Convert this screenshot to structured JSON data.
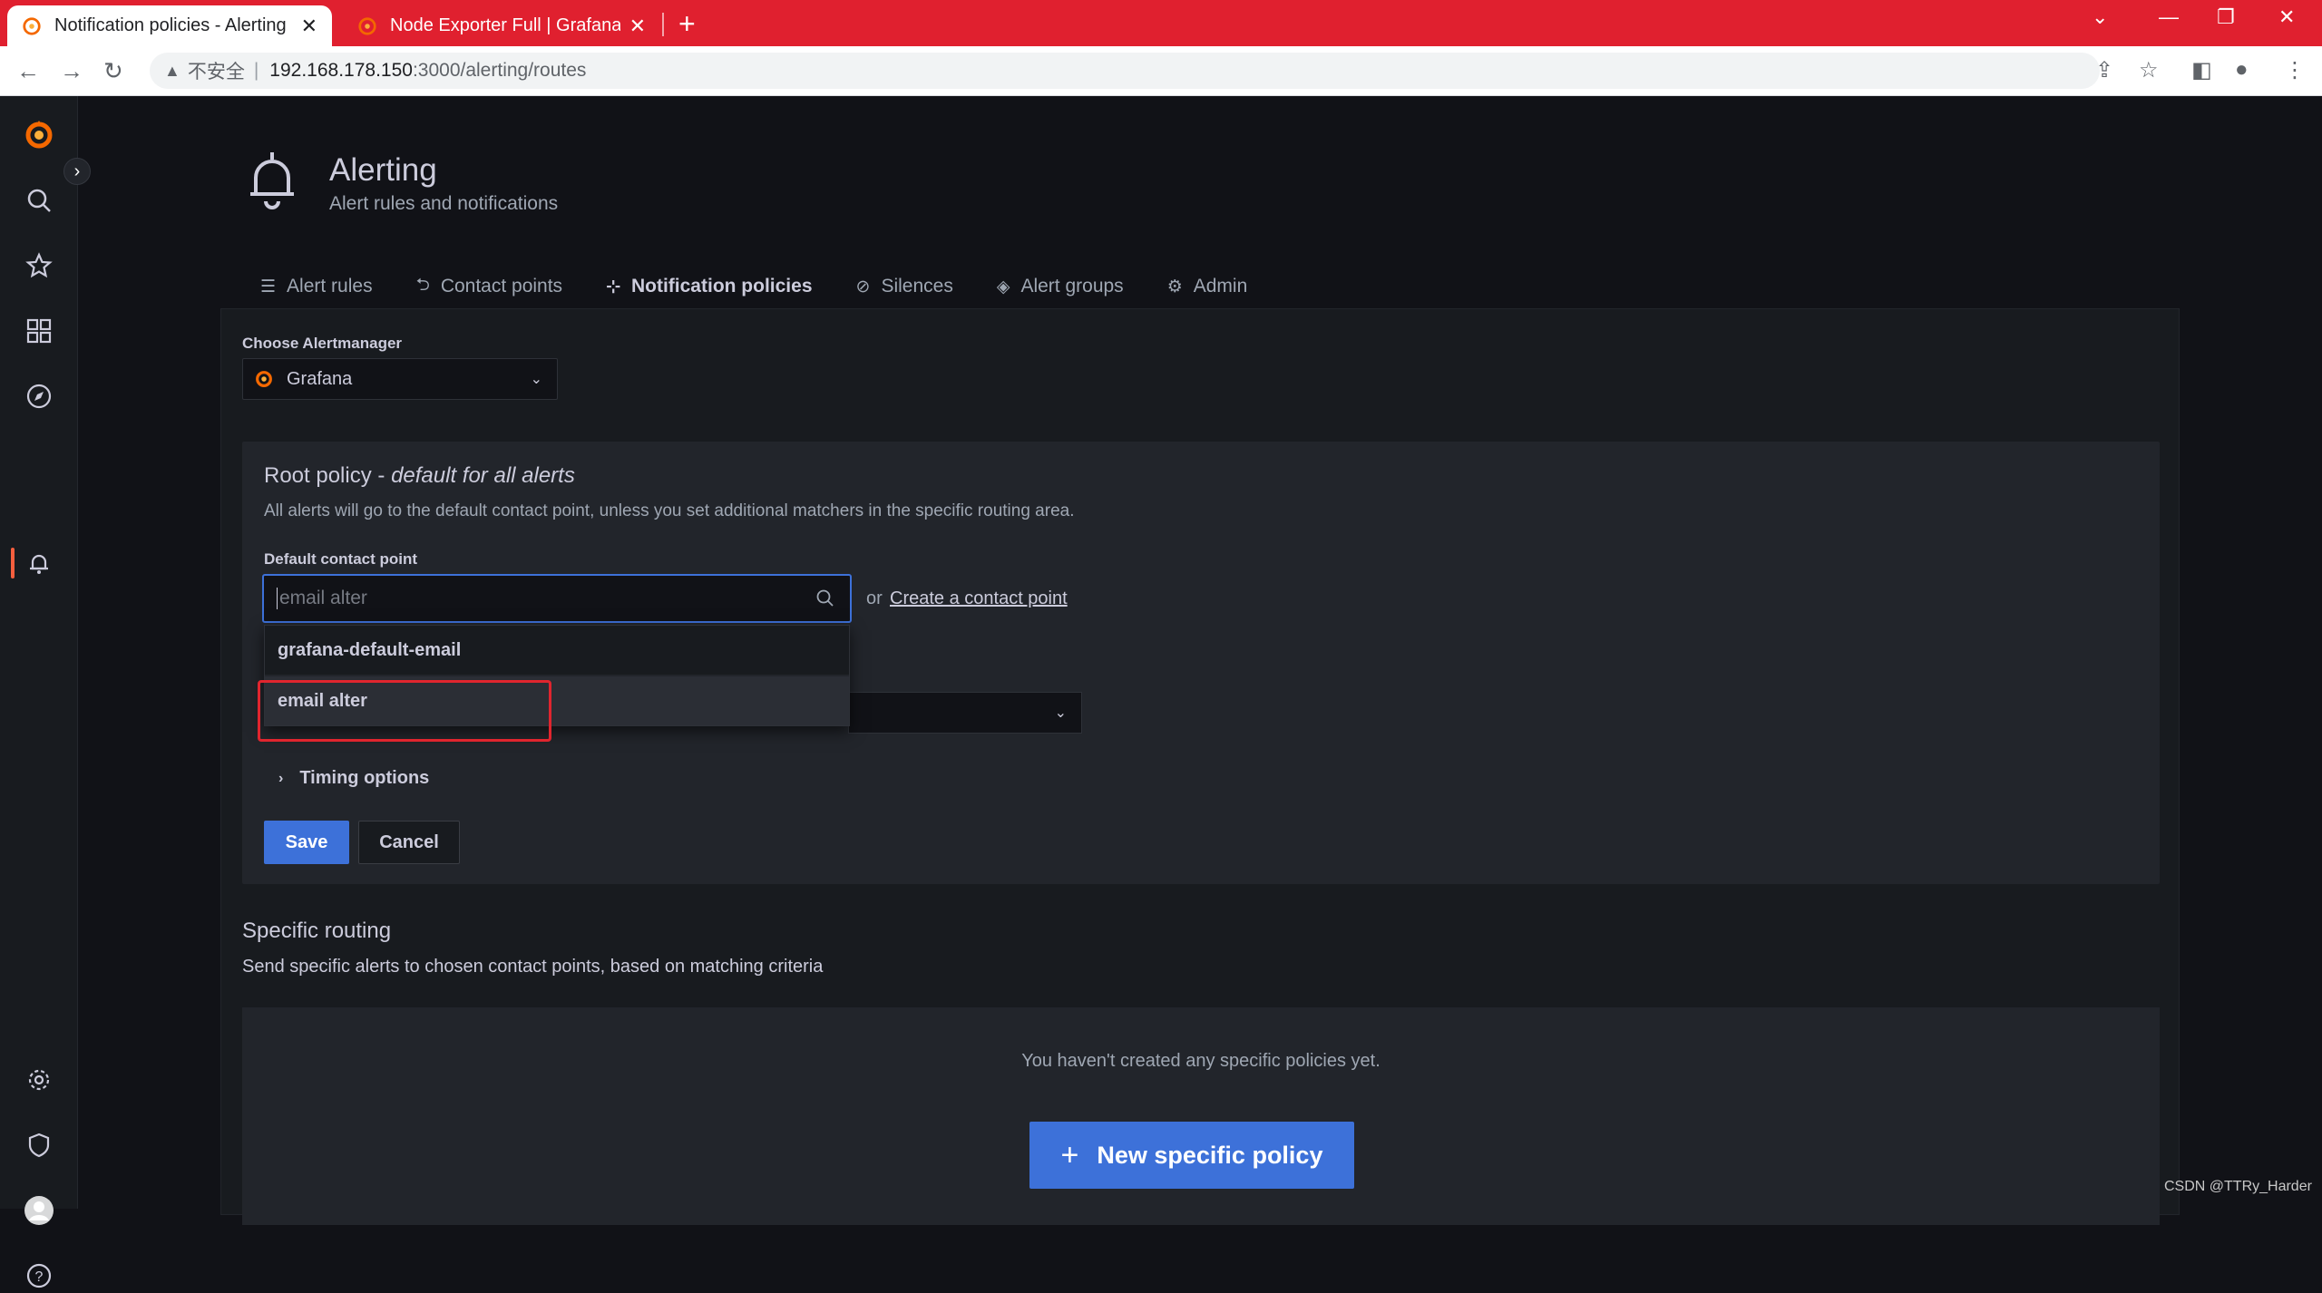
{
  "browser": {
    "tabs": [
      {
        "title": "Notification policies - Alerting",
        "active": true
      },
      {
        "title": "Node Exporter Full | Grafana L",
        "active": false
      }
    ],
    "close_glyph": "✕",
    "new_tab_glyph": "+",
    "address": {
      "security_label": "不安全",
      "host": "192.168.178.150",
      "path": ":3000/alerting/routes"
    }
  },
  "sidebar": {
    "items": [
      "grafana-logo",
      "search",
      "starred",
      "dashboards",
      "explore",
      "alerting",
      "configuration",
      "server-admin",
      "profile",
      "help"
    ],
    "active": "alerting"
  },
  "page": {
    "title": "Alerting",
    "subtitle": "Alert rules and notifications",
    "tabs": [
      {
        "label": "Alert rules",
        "icon": "list-icon"
      },
      {
        "label": "Contact points",
        "icon": "comment-alt-share-icon"
      },
      {
        "label": "Notification policies",
        "icon": "sitemap-icon",
        "active": true
      },
      {
        "label": "Silences",
        "icon": "bell-slash-icon"
      },
      {
        "label": "Alert groups",
        "icon": "layer-group-icon"
      },
      {
        "label": "Admin",
        "icon": "cog-icon"
      }
    ]
  },
  "alertmanager": {
    "label": "Choose Alertmanager",
    "selected": "Grafana"
  },
  "root_policy": {
    "title": "Root policy - ",
    "title_em": "default for all alerts",
    "description": "All alerts will go to the default contact point, unless you set additional matchers in the specific routing area.",
    "default_contact_label": "Default contact point",
    "input_placeholder": "email alter",
    "or_text": "or",
    "create_link": "Create a contact point",
    "options": [
      "grafana-default-email",
      "email alter"
    ],
    "highlighted_option": "email alter",
    "timing_label": "Timing options",
    "save_label": "Save",
    "cancel_label": "Cancel"
  },
  "specific_routing": {
    "title": "Specific routing",
    "description": "Send specific alerts to chosen contact points, based on matching criteria",
    "empty_text": "You haven't created any specific policies yet.",
    "new_button": "New specific policy"
  },
  "watermark": "CSDN @TTRy_Harder",
  "colors": {
    "accent": "#3d71d9",
    "brand": "#f55f3e",
    "chrome_tab_bar": "#e0202f",
    "highlight_box": "#e0252e"
  }
}
